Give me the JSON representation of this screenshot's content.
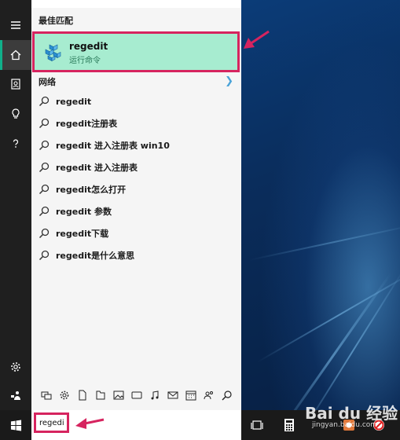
{
  "rail": {
    "items": [
      {
        "name": "hamburger-menu-icon"
      },
      {
        "name": "home-icon"
      },
      {
        "name": "notebook-icon"
      },
      {
        "name": "lightbulb-icon"
      },
      {
        "name": "help-icon"
      }
    ],
    "bottom_items": [
      {
        "name": "settings-gear-icon"
      },
      {
        "name": "feedback-icon"
      }
    ]
  },
  "panel": {
    "best_match_label": "最佳匹配",
    "best_match": {
      "title": "regedit",
      "subtitle": "运行命令",
      "icon": "registry-editor-icon"
    },
    "web_label": "网络",
    "results": [
      "regedit",
      "regedit注册表",
      "regedit 进入注册表 win10",
      "regedit 进入注册表",
      "regedit怎么打开",
      "regedit 参数",
      "regedit下载",
      "regedit是什么意思"
    ],
    "filters": [
      "apps-filter-icon",
      "settings-filter-icon",
      "documents-filter-icon",
      "folders-filter-icon",
      "photos-filter-icon",
      "videos-filter-icon",
      "music-filter-icon",
      "email-filter-icon",
      "calendar-filter-icon",
      "people-filter-icon",
      "web-search-filter-icon"
    ]
  },
  "taskbar": {
    "search_value": "regedit",
    "icons": [
      "task-view-icon",
      "calculator-icon",
      "app-icon",
      "app-icon-red"
    ]
  },
  "watermark": {
    "text": "Bai du 经验",
    "url": "jingyan.baidu.com"
  },
  "colors": {
    "accent": "#10b08a",
    "highlight": "#a7ecd0",
    "annotation": "#d6245f",
    "rail": "#1f1f1f"
  }
}
